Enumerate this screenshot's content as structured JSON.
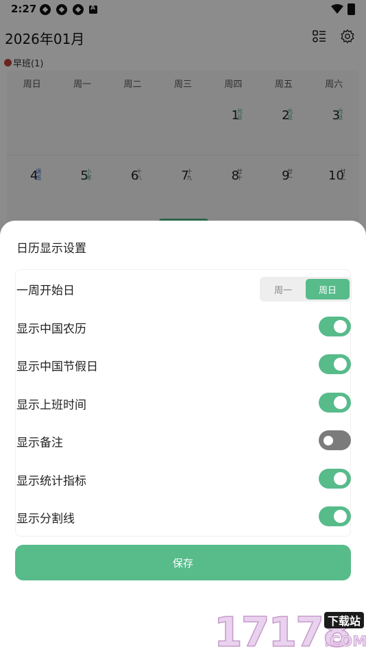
{
  "status_bar": {
    "time": "2:27",
    "notification_letter": "A"
  },
  "calendar": {
    "title": "2026年01月",
    "shift_legend": "早班(1)",
    "shift_color": "#c2413a",
    "weekdays": [
      "周日",
      "周一",
      "周二",
      "周三",
      "周四",
      "周五",
      "周六"
    ],
    "row1": [
      {
        "num": "1",
        "lunar": "元旦",
        "tone": "green"
      },
      {
        "num": "2",
        "lunar": "元旦",
        "tone": "green"
      },
      {
        "num": "3",
        "lunar": "元旦",
        "tone": "green"
      }
    ],
    "row2": [
      {
        "num": "4",
        "lunar": "调班",
        "tone": "blue"
      },
      {
        "num": "5",
        "lunar": "小寒",
        "tone": "green"
      },
      {
        "num": "6",
        "lunar": "十八",
        "tone": ""
      },
      {
        "num": "7",
        "lunar": "十九",
        "tone": ""
      },
      {
        "num": "8",
        "lunar": "廿十",
        "tone": ""
      },
      {
        "num": "9",
        "lunar": "廿一",
        "tone": ""
      },
      {
        "num": "10",
        "lunar": "廿二",
        "tone": ""
      }
    ]
  },
  "sheet": {
    "title": "日历显示设置",
    "week_start": {
      "label": "一周开始日",
      "option_mon": "周一",
      "option_sun": "周日",
      "selected": "周日"
    },
    "toggles": [
      {
        "label": "显示中国农历",
        "on": true
      },
      {
        "label": "显示中国节假日",
        "on": true
      },
      {
        "label": "显示上班时间",
        "on": true
      },
      {
        "label": "显示备注",
        "on": false
      },
      {
        "label": "显示统计指标",
        "on": true
      },
      {
        "label": "显示分割线",
        "on": true
      }
    ],
    "save_label": "保存"
  },
  "colors": {
    "accent": "#57bb8a",
    "toggle_off": "#7b7b7b"
  },
  "watermark": {
    "digits": "17178",
    "badge": "下载站",
    "suffix": ".COM"
  }
}
